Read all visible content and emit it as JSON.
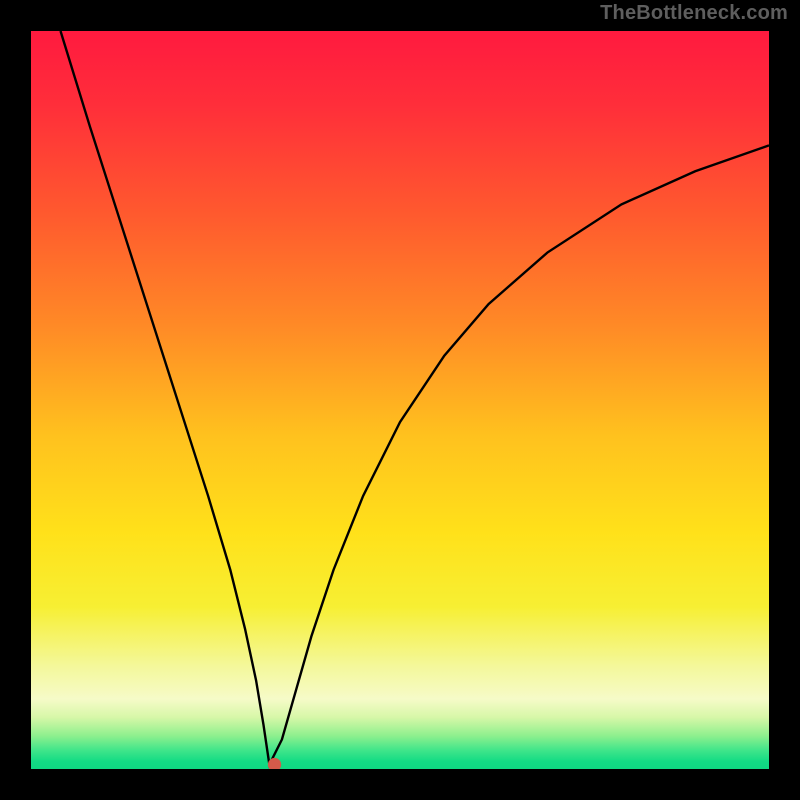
{
  "attribution": "TheBottleneck.com",
  "colors": {
    "page_bg": "#000000",
    "attribution_text": "#5e5e5e",
    "curve_stroke": "#000000",
    "marker_fill": "#d45a4a",
    "gradient_stops": [
      {
        "offset": 0.0,
        "color": "#ff1a3f"
      },
      {
        "offset": 0.1,
        "color": "#ff2e3a"
      },
      {
        "offset": 0.25,
        "color": "#ff5a2e"
      },
      {
        "offset": 0.4,
        "color": "#ff8a26"
      },
      {
        "offset": 0.55,
        "color": "#ffc21e"
      },
      {
        "offset": 0.68,
        "color": "#ffe11a"
      },
      {
        "offset": 0.78,
        "color": "#f7ef33"
      },
      {
        "offset": 0.86,
        "color": "#f4f89a"
      },
      {
        "offset": 0.905,
        "color": "#f6fbc8"
      },
      {
        "offset": 0.93,
        "color": "#d7f7a8"
      },
      {
        "offset": 0.955,
        "color": "#8ef08e"
      },
      {
        "offset": 0.975,
        "color": "#3fe58a"
      },
      {
        "offset": 0.99,
        "color": "#12db84"
      },
      {
        "offset": 1.0,
        "color": "#0fd882"
      }
    ]
  },
  "chart_data": {
    "type": "line",
    "title": "",
    "xlabel": "",
    "ylabel": "",
    "xlim": [
      0,
      100
    ],
    "ylim": [
      0,
      100
    ],
    "grid": false,
    "legend": false,
    "series": [
      {
        "name": "curve",
        "x": [
          4,
          8,
          12,
          16,
          20,
          24,
          27,
          29,
          30.5,
          31.5,
          32.3,
          34,
          36,
          38,
          41,
          45,
          50,
          56,
          62,
          70,
          80,
          90,
          100
        ],
        "y": [
          100,
          87,
          74.5,
          62,
          49.5,
          37,
          27,
          19,
          12,
          6,
          0.6,
          4,
          11,
          18,
          27,
          37,
          47,
          56,
          63,
          70,
          76.5,
          81,
          84.5
        ]
      }
    ],
    "marker": {
      "x": 33.0,
      "y": 0.6,
      "radius": 0.9
    },
    "notes": "Background vertical gradient from red (top) through orange/yellow to green (bottom). Curve minimum near x≈32.5."
  }
}
